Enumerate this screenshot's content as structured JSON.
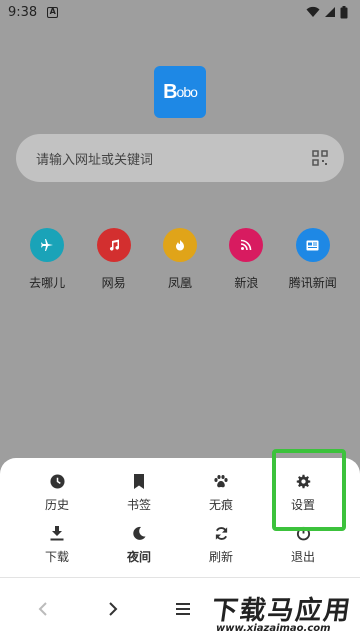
{
  "status_bar": {
    "time": "9:38",
    "notif_letter": "A"
  },
  "logo": {
    "text_big": "B",
    "text_small": "obo"
  },
  "search": {
    "placeholder": "请输入网址或关键词"
  },
  "shortcuts": [
    {
      "label": "去哪儿",
      "color": "#1aa3b8",
      "icon": "airplane-icon"
    },
    {
      "label": "网易",
      "color": "#d32f2f",
      "icon": "music-note-icon"
    },
    {
      "label": "凤凰",
      "color": "#e0a419",
      "icon": "fire-icon"
    },
    {
      "label": "新浪",
      "color": "#d81b60",
      "icon": "rss-icon"
    },
    {
      "label": "腾讯新闻",
      "color": "#1e88e5",
      "icon": "news-icon"
    }
  ],
  "menu": {
    "history": "历史",
    "bookmarks": "书签",
    "incognito": "无痕",
    "settings": "设置",
    "downloads": "下载",
    "night": "夜间",
    "refresh": "刷新",
    "exit": "退出"
  },
  "watermark": {
    "big": "下载马应用",
    "small": "www.xiazaimao.com"
  },
  "colors": {
    "highlight": "#3cc23c",
    "sheet": "#ffffff",
    "backdrop": "#9e9e9e"
  }
}
